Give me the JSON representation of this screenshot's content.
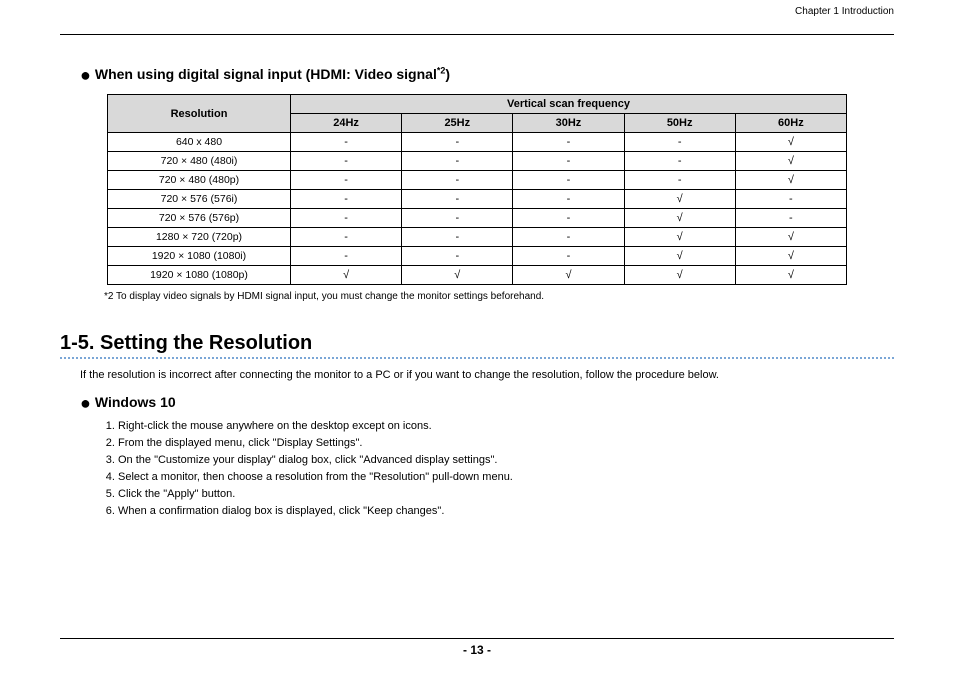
{
  "header": {
    "chapter": "Chapter 1  Introduction"
  },
  "section1": {
    "bullet": "●",
    "title_prefix": "When using digital signal input (HDMI: Video signal",
    "title_sup": "*2",
    "title_suffix": ")"
  },
  "table": {
    "col_resolution": "Resolution",
    "col_vsf": "Vertical scan frequency",
    "freq_labels": [
      "24Hz",
      "25Hz",
      "30Hz",
      "50Hz",
      "60Hz"
    ],
    "rows": [
      {
        "res": "640 x 480",
        "vals": [
          "-",
          "-",
          "-",
          "-",
          "√"
        ]
      },
      {
        "res": "720 × 480 (480i)",
        "vals": [
          "-",
          "-",
          "-",
          "-",
          "√"
        ]
      },
      {
        "res": "720 × 480 (480p)",
        "vals": [
          "-",
          "-",
          "-",
          "-",
          "√"
        ]
      },
      {
        "res": "720 × 576 (576i)",
        "vals": [
          "-",
          "-",
          "-",
          "√",
          "-"
        ]
      },
      {
        "res": "720 × 576 (576p)",
        "vals": [
          "-",
          "-",
          "-",
          "√",
          "-"
        ]
      },
      {
        "res": "1280 × 720 (720p)",
        "vals": [
          "-",
          "-",
          "-",
          "√",
          "√"
        ]
      },
      {
        "res": "1920 × 1080 (1080i)",
        "vals": [
          "-",
          "-",
          "-",
          "√",
          "√"
        ]
      },
      {
        "res": "1920 × 1080 (1080p)",
        "vals": [
          "√",
          "√",
          "√",
          "√",
          "√"
        ]
      }
    ],
    "footnote": "*2  To display video signals by HDMI signal input, you must change the monitor settings beforehand."
  },
  "section2": {
    "number": "1-5.",
    "title": "Setting the Resolution",
    "intro": "If the resolution is incorrect after connecting the monitor to a PC or if you want to change the resolution, follow the procedure below."
  },
  "subsection": {
    "bullet": "●",
    "title": "Windows 10",
    "steps": [
      "Right-click the mouse anywhere on the desktop except on icons.",
      "From the displayed menu, click \"Display Settings\".",
      "On the \"Customize your display\" dialog box, click \"Advanced display settings\".",
      "Select a monitor, then choose a resolution from the \"Resolution\" pull-down menu.",
      "Click the \"Apply\" button.",
      "When a confirmation dialog box is displayed, click \"Keep changes\"."
    ]
  },
  "footer": {
    "page": "- 13 -"
  }
}
